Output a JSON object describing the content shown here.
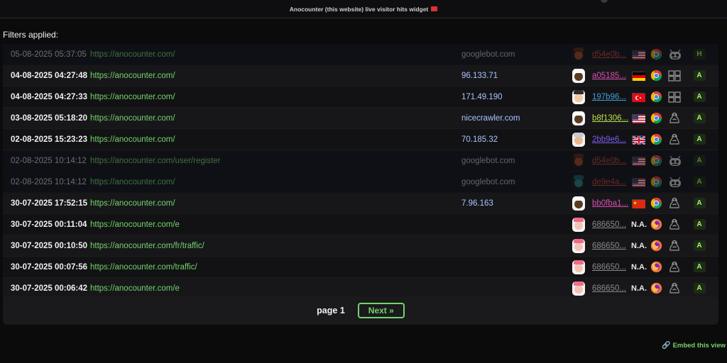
{
  "widget_title": "Anocounter (this website) live visitor hits widget",
  "filters_label": "Filters applied:",
  "pager": {
    "page_label": "page 1",
    "next_label": "Next »"
  },
  "embed_label": "Embed this view",
  "colors": {
    "accent": "#74d36b",
    "host": "#a9c3ff"
  },
  "rows": [
    {
      "time": "05-08-2025 05:37:05",
      "url": "https://anocounter.com/",
      "host": "googlebot.com",
      "hash": "d54e0b...",
      "hash_color": "#c0493a",
      "flag": "us",
      "browser": "chrome",
      "os": "bot",
      "level": "H",
      "bot": true,
      "avatar": "robot-brown"
    },
    {
      "time": "04-08-2025 04:27:48",
      "url": "https://anocounter.com/",
      "host": "96.133.71",
      "hash": "a05185...",
      "hash_color": "#d84fb2",
      "flag": "de",
      "browser": "chrome",
      "os": "windows",
      "level": "A",
      "bot": false,
      "avatar": "chef-dark"
    },
    {
      "time": "04-08-2025 04:27:33",
      "url": "https://anocounter.com/",
      "host": "171.49.190",
      "hash": "197b96...",
      "hash_color": "#3e9fd8",
      "flag": "tr",
      "browser": "chrome",
      "os": "windows",
      "level": "A",
      "bot": false,
      "avatar": "person-light"
    },
    {
      "time": "03-08-2025 05:18:20",
      "url": "https://anocounter.com/",
      "host": "nicecrawler.com",
      "hash": "b8f1306...",
      "hash_color": "#b8e04a",
      "flag": "us",
      "browser": "chrome",
      "os": "linux",
      "level": "A",
      "bot": false,
      "avatar": "chef-dark"
    },
    {
      "time": "02-08-2025 15:23:23",
      "url": "https://anocounter.com/",
      "host": "70.185.32",
      "hash": "2bb9e6...",
      "hash_color": "#7d5cf0",
      "flag": "gb",
      "browser": "chrome",
      "os": "linux",
      "level": "A",
      "bot": false,
      "avatar": "person-turban"
    },
    {
      "time": "02-08-2025 10:14:12",
      "url": "https://anocounter.com/user/register",
      "host": "googlebot.com",
      "hash": "d54e0b...",
      "hash_color": "#c0493a",
      "flag": "us",
      "browser": "chrome",
      "os": "bot",
      "level": "A",
      "bot": true,
      "avatar": "robot-brown"
    },
    {
      "time": "02-08-2025 10:14:12",
      "url": "https://anocounter.com/",
      "host": "googlebot.com",
      "hash": "de9e4a...",
      "hash_color": "#c0493a",
      "flag": "us",
      "browser": "chrome",
      "os": "bot",
      "level": "A",
      "bot": true,
      "avatar": "robot-teal"
    },
    {
      "time": "30-07-2025 17:52:15",
      "url": "https://anocounter.com/",
      "host": "7.96.163",
      "hash": "bb0fba1...",
      "hash_color": "#d84fb2",
      "flag": "cn",
      "browser": "chrome",
      "os": "linux",
      "level": "A",
      "bot": false,
      "avatar": "chef-dark"
    },
    {
      "time": "30-07-2025 00:11:04",
      "url": "https://anocounter.com/e",
      "host": "",
      "hash": "686650...",
      "hash_color": "#8a8a8a",
      "flag": "",
      "na": "N.A.",
      "browser": "firefox",
      "os": "linux",
      "level": "A",
      "bot": false,
      "avatar": "person-pink"
    },
    {
      "time": "30-07-2025 00:10:50",
      "url": "https://anocounter.com/fr/traffic/",
      "host": "",
      "hash": "686650...",
      "hash_color": "#8a8a8a",
      "flag": "",
      "na": "N.A.",
      "browser": "firefox",
      "os": "linux",
      "level": "A",
      "bot": false,
      "avatar": "person-pink"
    },
    {
      "time": "30-07-2025 00:07:56",
      "url": "https://anocounter.com/traffic/",
      "host": "",
      "hash": "686650...",
      "hash_color": "#8a8a8a",
      "flag": "",
      "na": "N.A.",
      "browser": "firefox",
      "os": "linux",
      "level": "A",
      "bot": false,
      "avatar": "person-pink"
    },
    {
      "time": "30-07-2025 00:06:42",
      "url": "https://anocounter.com/e",
      "host": "",
      "hash": "686650...",
      "hash_color": "#8a8a8a",
      "flag": "",
      "na": "N.A.",
      "browser": "firefox",
      "os": "linux",
      "level": "A",
      "bot": false,
      "avatar": "person-pink"
    }
  ]
}
